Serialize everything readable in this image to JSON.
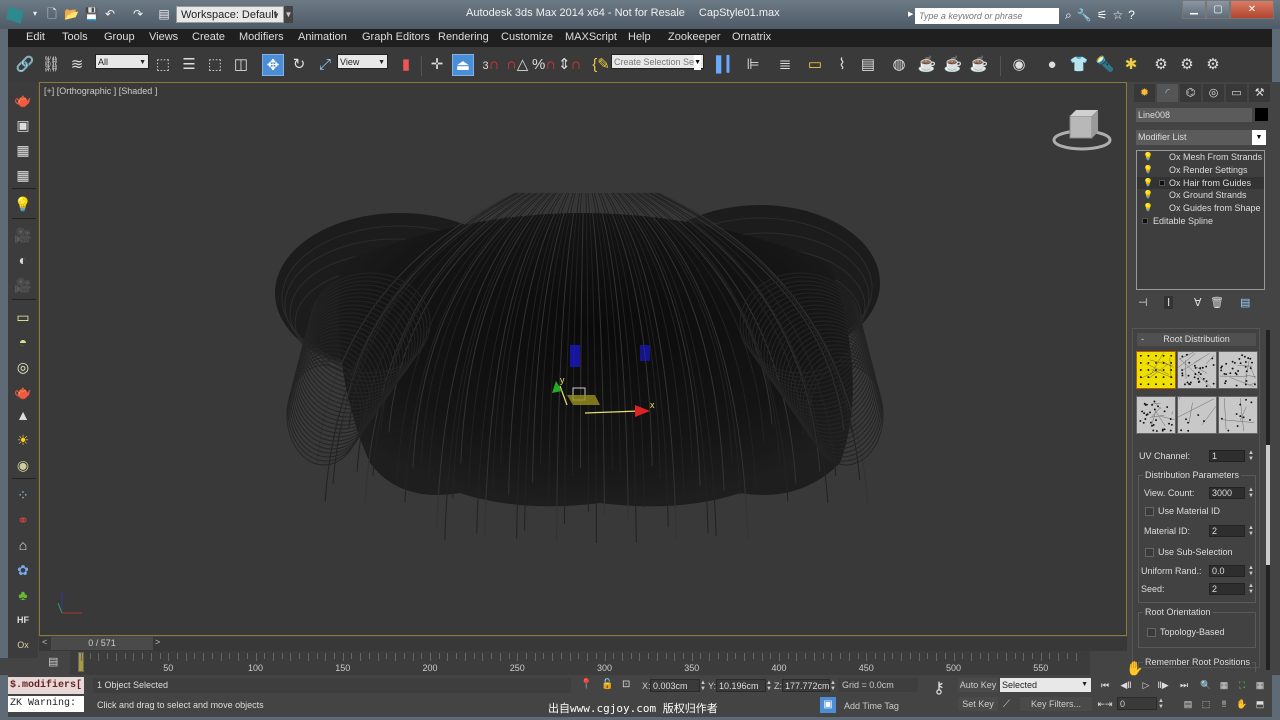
{
  "titlebar": {
    "workspace": "Workspace: Default",
    "app_title": "Autodesk 3ds Max  2014 x64   - Not for Resale",
    "file_name": "CapStyle01.max",
    "search_placeholder": "Type a keyword or phrase",
    "icons": [
      "new-file-icon",
      "open-file-icon",
      "save-icon",
      "undo-icon",
      "redo-icon",
      "project-folder-icon"
    ]
  },
  "menu": [
    "Edit",
    "Tools",
    "Group",
    "Views",
    "Create",
    "Modifiers",
    "Animation",
    "Graph Editors",
    "Rendering",
    "Customize",
    "MAXScript",
    "Help",
    "Zookeeper",
    "Ornatrix"
  ],
  "toolbar": {
    "selection_filter": "All",
    "ref_coord": "View",
    "named_selection_placeholder": "Create Selection Se"
  },
  "viewport": {
    "label": "[+] [Orthographic ] [Shaded ]",
    "gizmo_axes": {
      "x": "x",
      "y": "y"
    }
  },
  "command_panel": {
    "tabs": [
      "create",
      "modify",
      "hierarchy",
      "motion",
      "display",
      "utilities"
    ],
    "object_name": "Line008",
    "object_color": "#000000",
    "modifier_list": "Modifier List",
    "stack": [
      {
        "label": "Ox Mesh From Strands",
        "has_plus": false,
        "selected": false
      },
      {
        "label": "Ox Render Settings",
        "has_plus": false,
        "selected": false
      },
      {
        "label": "Ox Hair from Guides",
        "has_plus": true,
        "selected": true
      },
      {
        "label": "Ox Ground Strands",
        "has_plus": false,
        "selected": false
      },
      {
        "label": "Ox Guides from Shape",
        "has_plus": false,
        "selected": false
      }
    ],
    "base_object": "Editable Spline",
    "rollout": {
      "title": "Root Distribution",
      "collapse": "-",
      "swatches_selected_index": 0,
      "uv_channel_label": "UV Channel:",
      "uv_channel": "1",
      "distribution_group": "Distribution Parameters",
      "view_count_label": "View. Count:",
      "view_count": "3000",
      "use_material_id_label": "Use Material ID",
      "use_material_id": false,
      "material_id_label": "Material ID:",
      "material_id": "2",
      "use_sub_selection_label": "Use Sub-Selection",
      "use_sub_selection": false,
      "uniform_rand_label": "Uniform Rand.:",
      "uniform_rand": "0.0",
      "seed_label": "Seed:",
      "seed": "2",
      "root_orientation_group": "Root Orientation",
      "topology_based_label": "Topology-Based",
      "topology_based": false,
      "remember_root_label": "Remember Root Positions"
    }
  },
  "timeline": {
    "time_slider": "0 / 571",
    "prev": "<",
    "next": ">",
    "ticks": [
      "50",
      "100",
      "150",
      "200",
      "250",
      "300",
      "350",
      "400",
      "450",
      "500",
      "550"
    ],
    "current_frame_marker": "0"
  },
  "status": {
    "maxscript_line1": "$.modifiers[:",
    "maxscript_line2": "ZK Warning: :",
    "selection": "1 Object Selected",
    "prompt": "Click and drag to select and move objects",
    "x_label": "X:",
    "x": "0.003cm",
    "y_label": "Y:",
    "y": "10.196cm",
    "z_label": "Z:",
    "z": "177.772cm",
    "grid": "Grid = 0.0cm",
    "add_time_tag": "Add Time Tag",
    "auto_key": "Auto Key",
    "set_key": "Set Key",
    "key_mode": "Selected",
    "key_filters": "Key Filters...",
    "current_frame": "0",
    "watermark": "出自www.cgjoy.com 版权归作者"
  }
}
